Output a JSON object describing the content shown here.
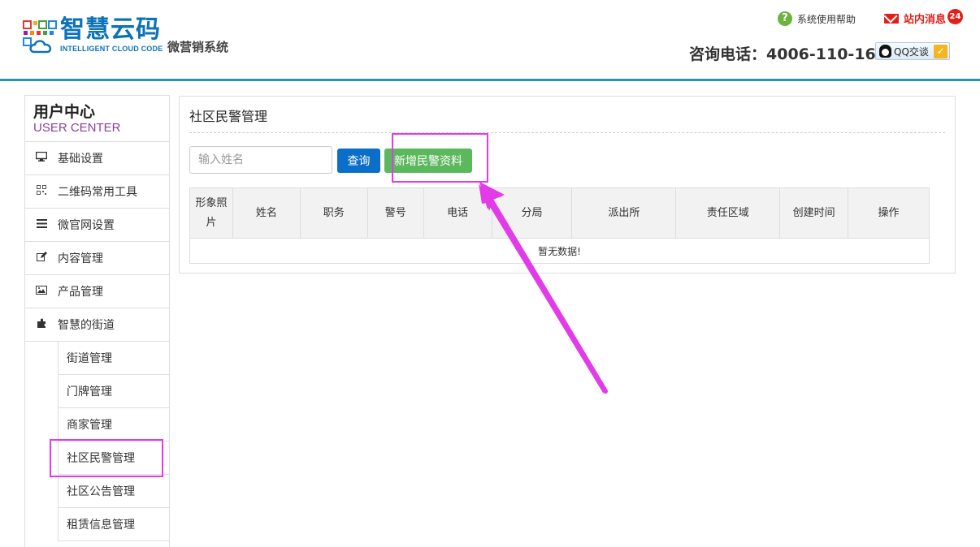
{
  "header": {
    "brand_cn": "智慧云码",
    "brand_en": "INTELLIGENT CLOUD CODE",
    "system_name": "微营销系统",
    "help_label": "系统使用帮助",
    "message_label": "站内消息",
    "message_count": "24",
    "phone": "咨询电话：4006-110-166",
    "qq_label": "QQ交谈"
  },
  "sidebar": {
    "title_cn": "用户中心",
    "title_en": "USER CENTER",
    "items": [
      {
        "label": "基础设置",
        "icon": "monitor-icon"
      },
      {
        "label": "二维码常用工具",
        "icon": "qrcode-icon"
      },
      {
        "label": "微官网设置",
        "icon": "list-icon"
      },
      {
        "label": "内容管理",
        "icon": "edit-icon"
      },
      {
        "label": "产品管理",
        "icon": "image-icon"
      },
      {
        "label": "智慧的街道",
        "icon": "puzzle-icon"
      }
    ],
    "subitems": [
      {
        "label": "街道管理"
      },
      {
        "label": "门牌管理"
      },
      {
        "label": "商家管理"
      },
      {
        "label": "社区民警管理"
      },
      {
        "label": "社区公告管理"
      },
      {
        "label": "租赁信息管理"
      }
    ]
  },
  "main": {
    "title": "社区民警管理",
    "search_placeholder": "输入姓名",
    "query_label": "查询",
    "add_label": "新增民警资料",
    "columns": [
      "形象照片",
      "姓名",
      "职务",
      "警号",
      "电话",
      "分局",
      "派出所",
      "责任区域",
      "创建时间",
      "操作"
    ],
    "empty_text": "暂无数据!"
  },
  "colors": {
    "brand": "#0d73b8",
    "header_border": "#2a91b4",
    "annotation": "#e23ce8",
    "query_button": "#0b6fc9",
    "add_button": "#5cb85c"
  }
}
